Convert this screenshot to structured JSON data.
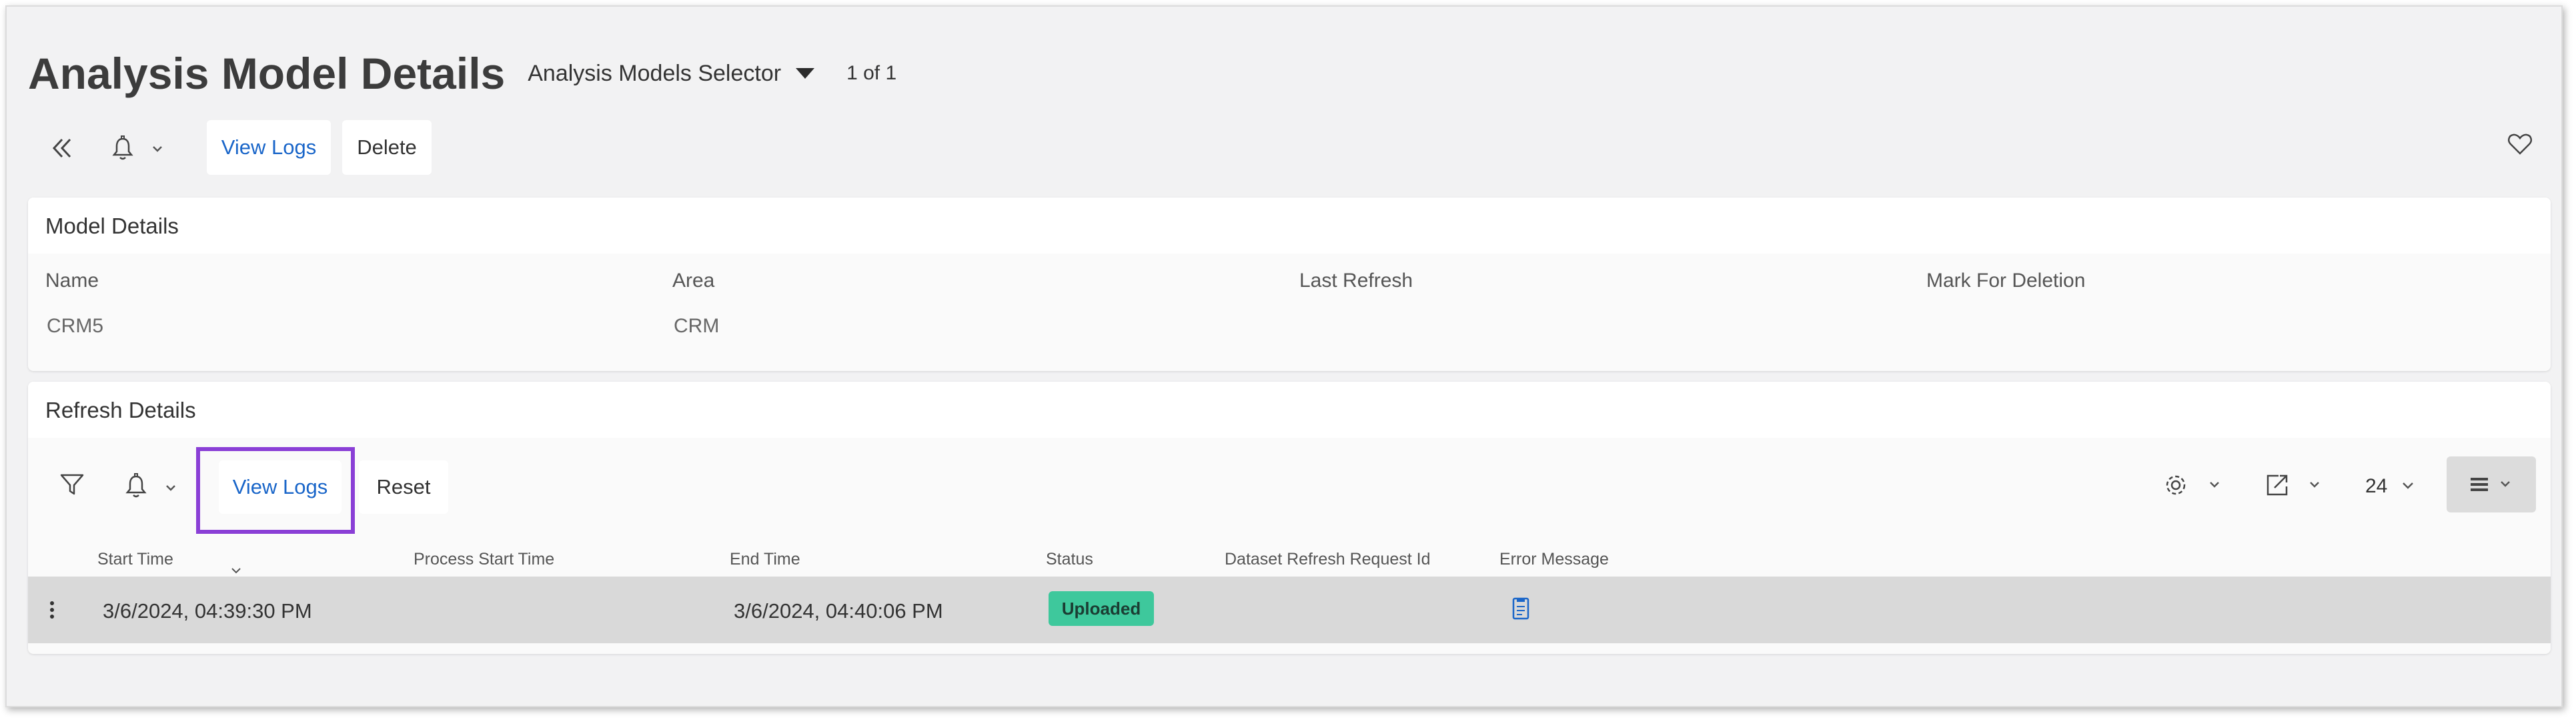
{
  "header": {
    "title": "Analysis Model Details",
    "selector_label": "Analysis Models Selector",
    "record_counter": "1 of 1"
  },
  "toolbar": {
    "view_logs_label": "View Logs",
    "delete_label": "Delete"
  },
  "model_details": {
    "title": "Model Details",
    "fields": [
      {
        "label": "Name",
        "value": "CRM5"
      },
      {
        "label": "Area",
        "value": "CRM"
      },
      {
        "label": "Last Refresh",
        "value": ""
      },
      {
        "label": "Mark For Deletion",
        "value": ""
      }
    ]
  },
  "refresh_details": {
    "title": "Refresh Details",
    "view_logs_label": "View Logs",
    "reset_label": "Reset",
    "page_size": "24",
    "columns": [
      "Start Time",
      "Process Start Time",
      "End Time",
      "Status",
      "Dataset Refresh Request Id",
      "Error Message"
    ],
    "rows": [
      {
        "start_time": "3/6/2024, 04:39:30 PM",
        "process_start_time": "",
        "end_time": "3/6/2024, 04:40:06 PM",
        "status": "Uploaded",
        "dataset_refresh_request_id": ""
      }
    ]
  },
  "colors": {
    "link": "#1a66c9",
    "status_uploaded": "#3ec89c",
    "highlight": "#8a3fd6"
  },
  "icons": [
    "collapse-double-chevron-icon",
    "bell-icon",
    "chevron-down-icon",
    "heart-icon",
    "filter-icon",
    "gear-icon",
    "export-icon",
    "list-view-icon",
    "kebab-menu-icon",
    "document-icon",
    "sort-arrow-icon"
  ]
}
